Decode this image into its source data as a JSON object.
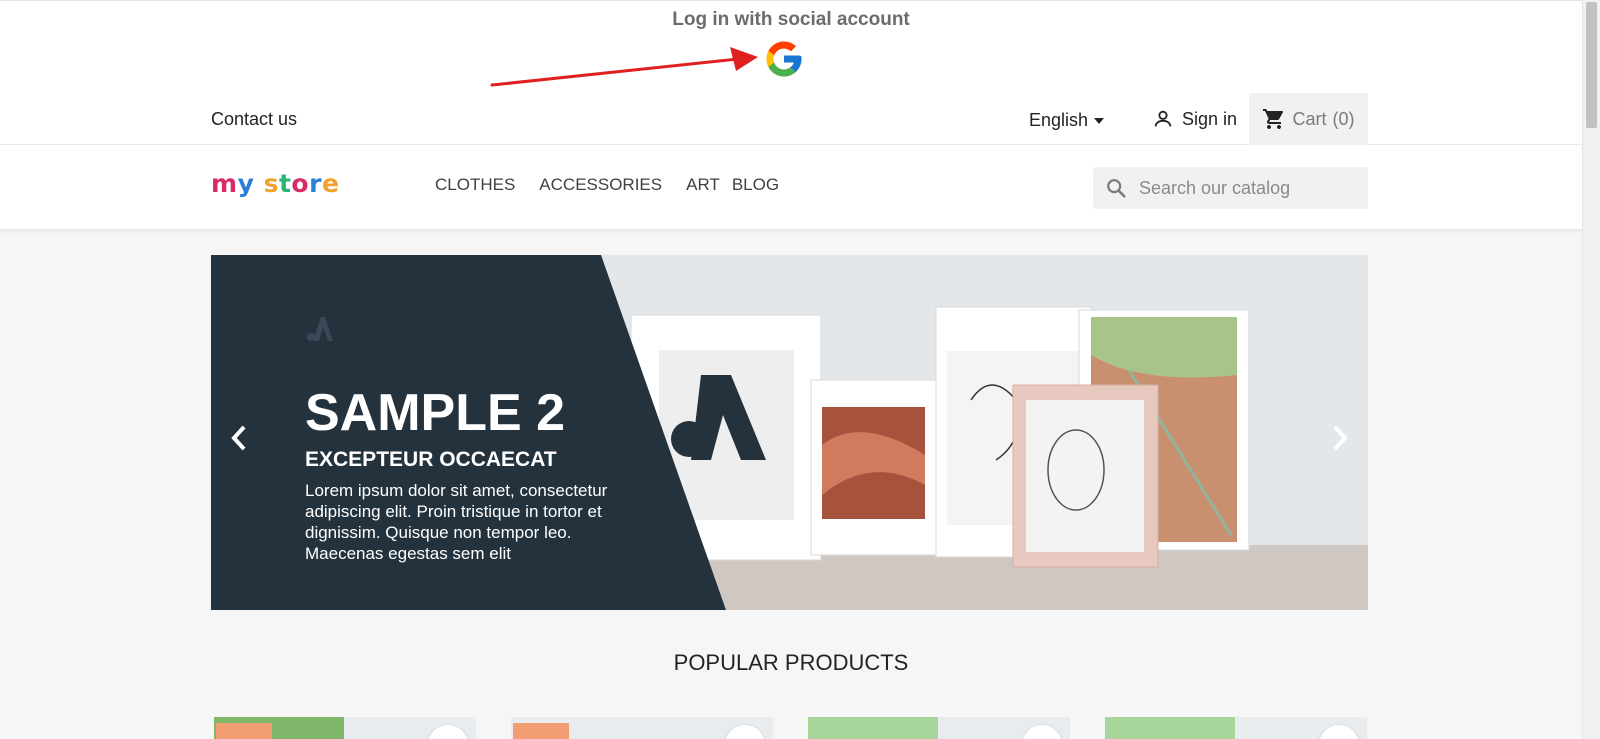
{
  "social_login": {
    "title": "Log in with social account",
    "provider_icon": "google-icon",
    "annotation_arrow_color": "#e02020"
  },
  "header_nav": {
    "contact": "Contact us",
    "language": "English",
    "signin": "Sign in",
    "cart_label": "Cart",
    "cart_count": "(0)"
  },
  "header_top": {
    "logo_letters": [
      "m",
      "y",
      " ",
      "s",
      "t",
      "o",
      "r",
      "e"
    ],
    "logo_colors": [
      "#d62b66",
      "#2b7fd6",
      "#ffffff",
      "#f0a02b",
      "#2bb673",
      "#d62b66",
      "#2b7fd6",
      "#f0a02b"
    ],
    "menu": [
      "CLOTHES",
      "ACCESSORIES",
      "ART",
      "BLOG"
    ],
    "search_placeholder": "Search our catalog"
  },
  "carousel": {
    "title": "SAMPLE 2",
    "subtitle": "EXCEPTEUR OCCAECAT",
    "text": "Lorem ipsum dolor sit amet, consectetur adipiscing elit. Proin tristique in tortor et dignissim. Quisque non tempor leo. Maecenas egestas sem elit",
    "panel_color": "#24323d",
    "prev_icon": "chevron-left-icon",
    "next_icon": "chevron-right-icon"
  },
  "popular": {
    "title": "POPULAR PRODUCTS"
  }
}
